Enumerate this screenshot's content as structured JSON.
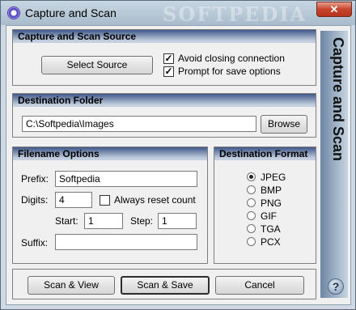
{
  "window": {
    "title": "Capture and Scan",
    "watermark": "SOFTPEDIA",
    "close_glyph": "✕"
  },
  "source": {
    "title": "Capture and Scan Source",
    "select_label": "Select Source",
    "avoid_closing": {
      "label": "Avoid closing connection",
      "checked": true
    },
    "prompt_save": {
      "label": "Prompt for save options",
      "checked": true
    }
  },
  "destination": {
    "title": "Destination Folder",
    "path": "C:\\Softpedia\\Images",
    "browse_label": "Browse"
  },
  "filename": {
    "title": "Filename Options",
    "prefix_label": "Prefix:",
    "prefix_value": "Softpedia",
    "digits_label": "Digits:",
    "digits_value": "4",
    "reset_label": "Always reset count",
    "reset_checked": false,
    "start_label": "Start:",
    "start_value": "1",
    "step_label": "Step:",
    "step_value": "1",
    "suffix_label": "Suffix:",
    "suffix_value": ""
  },
  "format": {
    "title": "Destination Format",
    "options": [
      "JPEG",
      "BMP",
      "PNG",
      "GIF",
      "TGA",
      "PCX"
    ],
    "selected": "JPEG"
  },
  "buttons": {
    "scan_view": "Scan & View",
    "scan_save": "Scan & Save",
    "cancel": "Cancel"
  },
  "side": {
    "label": "Capture and Scan"
  },
  "help": {
    "glyph": "?"
  }
}
